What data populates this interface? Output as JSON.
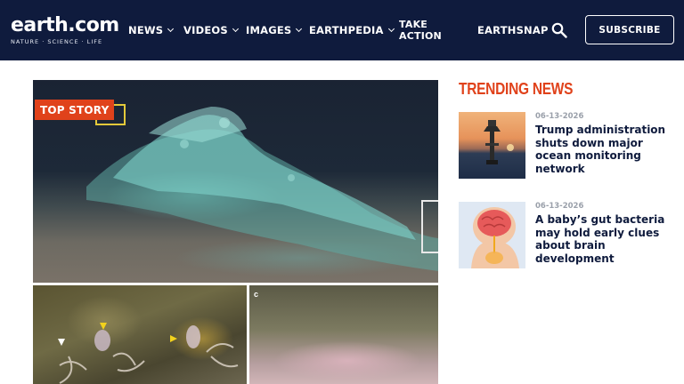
{
  "header": {
    "logo_word": "earth.com",
    "logo_tagline": "NATURE · SCIENCE · LIFE",
    "nav": [
      {
        "label": "NEWS",
        "has_dropdown": true
      },
      {
        "label": "VIDEOS",
        "has_dropdown": true
      },
      {
        "label": "IMAGES",
        "has_dropdown": true
      },
      {
        "label": "EARTHPEDIA",
        "has_dropdown": true
      },
      {
        "label_line1": "TAKE",
        "label_line2": "ACTION",
        "has_dropdown": false
      },
      {
        "label": "EARTHSNAP",
        "has_dropdown": false
      }
    ],
    "search_icon": "search-icon",
    "subscribe_label": "SUBSCRIBE"
  },
  "hero": {
    "badge": "TOP STORY",
    "panel_label": "c"
  },
  "trending": {
    "title": "TRENDING NEWS",
    "stories": [
      {
        "date": "06-13-2026",
        "headline": "Trump administration shuts down major ocean monitoring network"
      },
      {
        "date": "06-13-2026",
        "headline": "A baby’s gut bacteria may hold early clues about brain development"
      }
    ]
  },
  "colors": {
    "header_bg": "#0f1b3d",
    "accent": "#e0421b",
    "headline": "#0f1b3d",
    "date": "#9aa0aa"
  }
}
